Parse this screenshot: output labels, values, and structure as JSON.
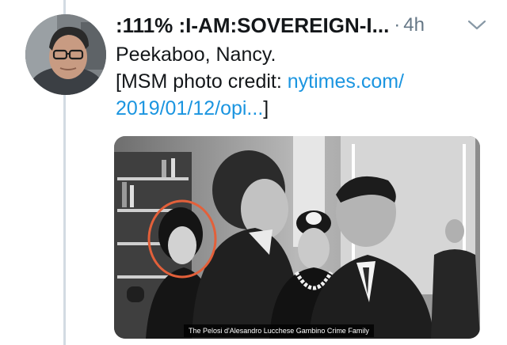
{
  "tweet": {
    "display_name": ":111% :I-AM:SOVEREIGN-I...",
    "separator": "·",
    "timestamp": "4h",
    "line1": "Peekaboo, Nancy.",
    "line2_prefix": "[MSM photo credit: ",
    "line2_link": "nytimes.com/",
    "line3_link": "2019/01/12/opi...",
    "line3_suffix": "]"
  },
  "media": {
    "caption": "The Pelosi d'Alesandro Lucchese Gambino Crime Family",
    "highlight_color": "#e3603a"
  },
  "icons": {
    "menu": "chevron-down-icon",
    "avatar": "avatar"
  },
  "colors": {
    "link": "#1b95e0",
    "text": "#14171a",
    "muted": "#657786",
    "thread_line": "#d3dbe2"
  }
}
